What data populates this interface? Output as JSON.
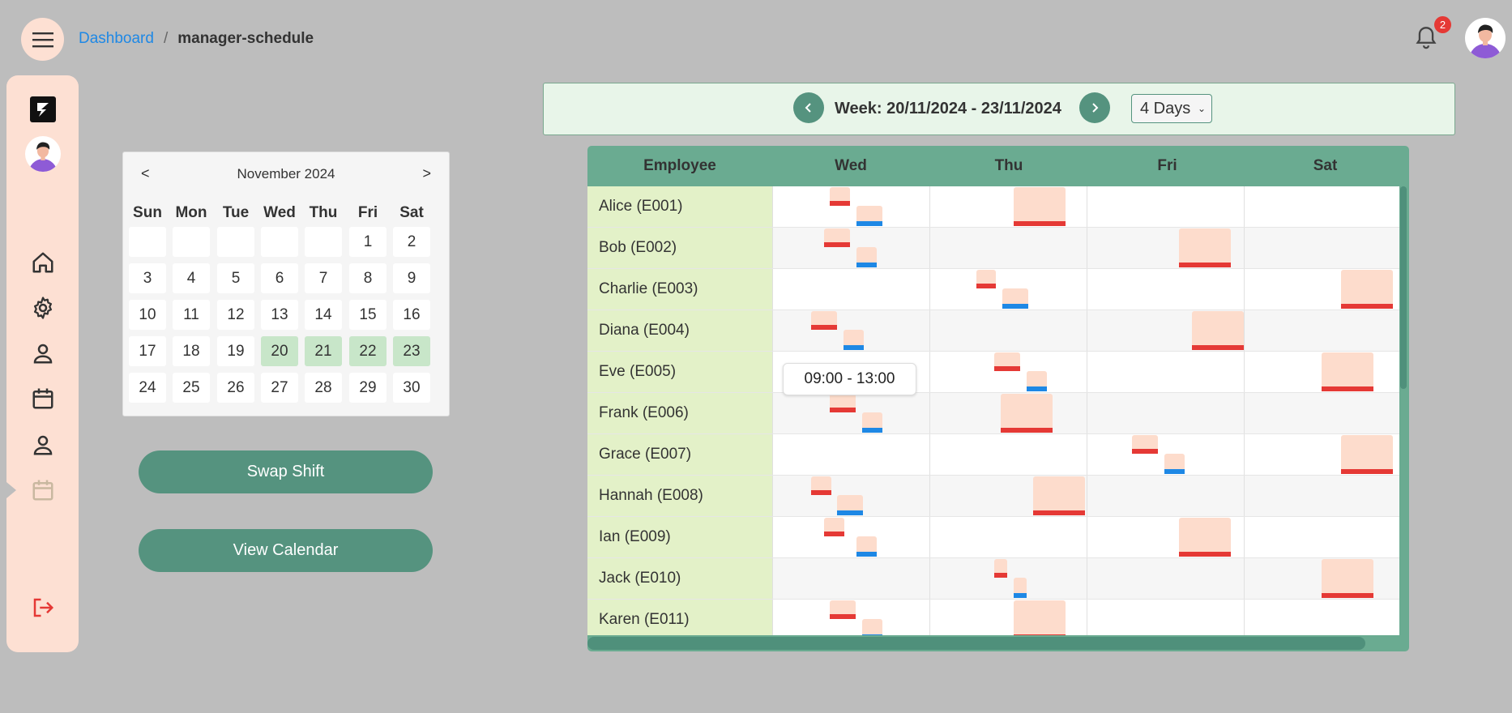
{
  "breadcrumb": {
    "home": "Dashboard",
    "separator": "/",
    "current": "manager-schedule"
  },
  "notifications": {
    "count": "2"
  },
  "sidebar": {
    "icons": [
      "home-icon",
      "settings-icon",
      "person-icon",
      "calendar-icon",
      "person-icon",
      "calendar-icon"
    ],
    "logout_icon": "logout-icon"
  },
  "mini_calendar": {
    "prev": "<",
    "next": ">",
    "title": "November 2024",
    "weekdays": [
      "Sun",
      "Mon",
      "Tue",
      "Wed",
      "Thu",
      "Fri",
      "Sat"
    ],
    "weeks": [
      [
        "",
        "",
        "",
        "",
        "",
        "1",
        "2"
      ],
      [
        "3",
        "4",
        "5",
        "6",
        "7",
        "8",
        "9"
      ],
      [
        "10",
        "11",
        "12",
        "13",
        "14",
        "15",
        "16"
      ],
      [
        "17",
        "18",
        "19",
        "20",
        "21",
        "22",
        "23"
      ],
      [
        "24",
        "25",
        "26",
        "27",
        "28",
        "29",
        "30"
      ]
    ],
    "selected": [
      "20",
      "21",
      "22",
      "23"
    ]
  },
  "actions": {
    "swap": "Swap Shift",
    "view": "View Calendar"
  },
  "week": {
    "label": "Week: 20/11/2024 - 23/11/2024",
    "range_option": "4 Days"
  },
  "schedule": {
    "headers": [
      "Employee",
      "Wed",
      "Thu",
      "Fri",
      "Sat"
    ],
    "employees": [
      "Alice (E001)",
      "Bob (E002)",
      "Charlie (E003)",
      "Diana (E004)",
      "Eve (E005)",
      "Frank (E006)",
      "Grace (E007)",
      "Hannah (E008)",
      "Ian (E009)",
      "Jack (E010)",
      "Karen (E011)"
    ],
    "tooltip": "09:00 - 13:00"
  },
  "colors": {
    "accent": "#55937f",
    "header": "#6aab91",
    "shift_red": "#e53935",
    "shift_blue": "#1e88e5",
    "shift_block": "#fddccc"
  }
}
